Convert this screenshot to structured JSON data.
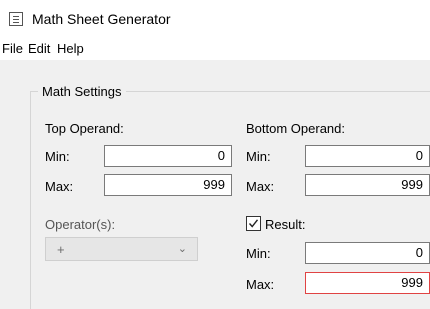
{
  "window": {
    "title": "Math Sheet Generator",
    "icon": "calculator-sheet-icon"
  },
  "menu": {
    "items": [
      "File",
      "Edit",
      "Help"
    ]
  },
  "settings": {
    "group_title": "Math Settings",
    "top_operand": {
      "label": "Top Operand:",
      "min_label": "Min:",
      "min_value": "0",
      "max_label": "Max:",
      "max_value": "999"
    },
    "bottom_operand": {
      "label": "Bottom Operand:",
      "min_label": "Min:",
      "min_value": "0",
      "max_label": "Max:",
      "max_value": "999"
    },
    "operators": {
      "label": "Operator(s):",
      "selected": "+",
      "icon": "chevron-down-icon"
    },
    "result": {
      "label": "Result:",
      "checked": true,
      "min_label": "Min:",
      "min_value": "0",
      "max_label": "Max:",
      "max_value": "999",
      "max_error_color": "#e04343"
    }
  }
}
